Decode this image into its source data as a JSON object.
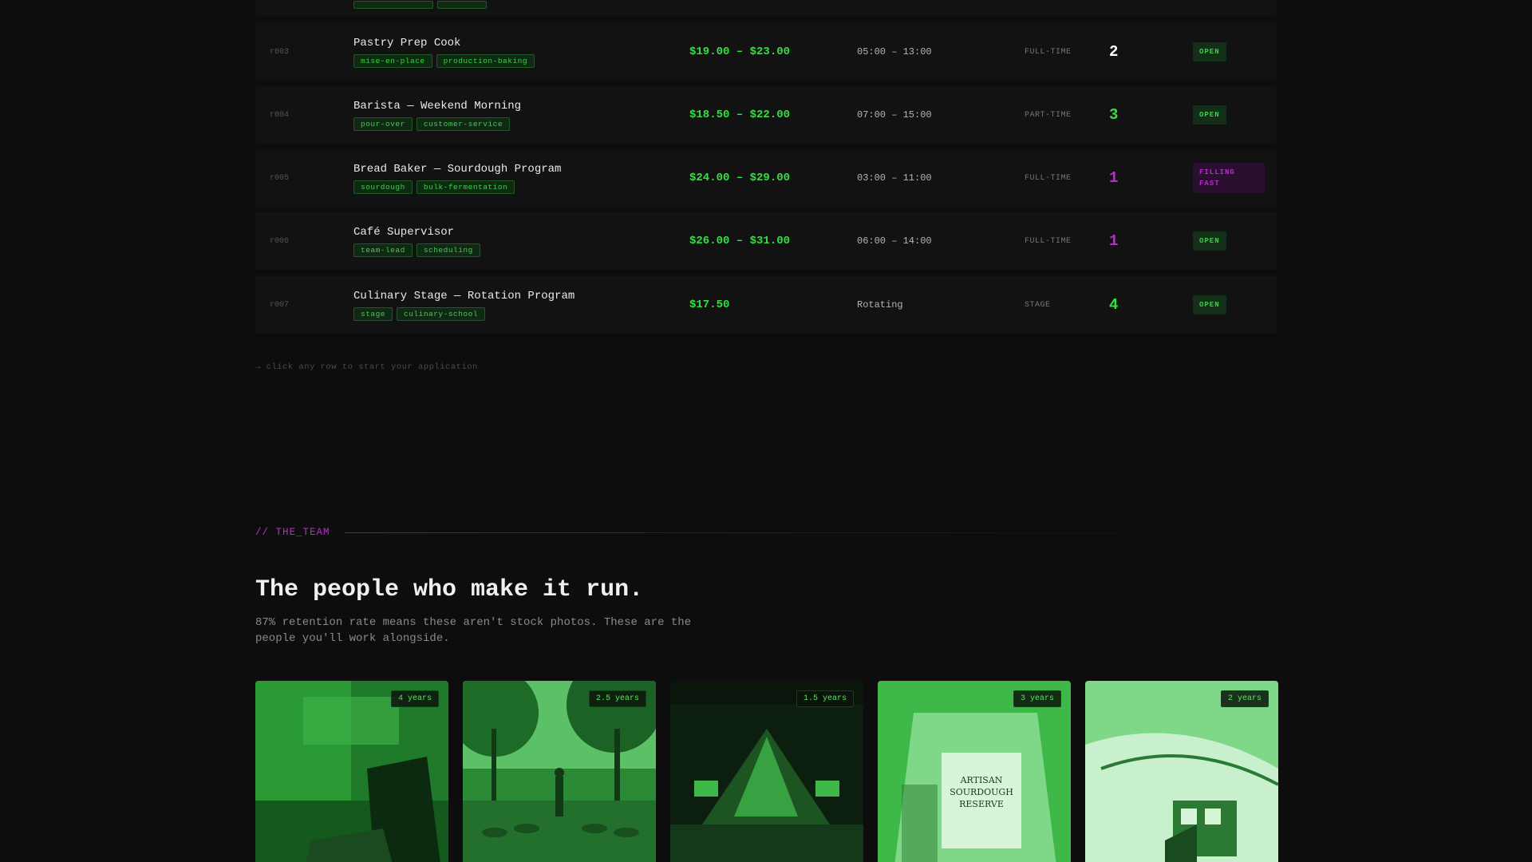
{
  "roles": [
    {
      "id": "r003",
      "title": "Pastry Prep Cook",
      "tags": [
        "mise-en-place",
        "production-baking"
      ],
      "pay": "$19.00 – $23.00",
      "shift": "05:00 – 13:00",
      "type": "FULL-TIME",
      "openings": "2",
      "openings_color": "#ffffff",
      "status": "OPEN"
    },
    {
      "id": "r004",
      "title": "Barista — Weekend Morning",
      "tags": [
        "pour-over",
        "customer-service"
      ],
      "pay": "$18.50 – $22.00",
      "shift": "07:00 – 15:00",
      "type": "PART-TIME",
      "openings": "3",
      "openings_color": "#33e03f",
      "status": "OPEN"
    },
    {
      "id": "r005",
      "title": "Bread Baker — Sourdough Program",
      "tags": [
        "sourdough",
        "bulk-fermentation"
      ],
      "pay": "$24.00 – $29.00",
      "shift": "03:00 – 11:00",
      "type": "FULL-TIME",
      "openings": "1",
      "openings_color": "#c026d3",
      "status": "FILLING FAST"
    },
    {
      "id": "r006",
      "title": "Café Supervisor",
      "tags": [
        "team-lead",
        "scheduling"
      ],
      "pay": "$26.00 – $31.00",
      "shift": "06:00 – 14:00",
      "type": "FULL-TIME",
      "openings": "1",
      "openings_color": "#c026d3",
      "status": "OPEN"
    },
    {
      "id": "r007",
      "title": "Culinary Stage — Rotation Program",
      "tags": [
        "stage",
        "culinary-school"
      ],
      "pay": "$17.50",
      "shift": "Rotating",
      "type": "STAGE",
      "openings": "4",
      "openings_color": "#33e03f",
      "status": "OPEN"
    }
  ],
  "hint": "→ click any row to start your application",
  "team": {
    "section_tag": "// THE_TEAM",
    "title": "The people who make it run.",
    "subtitle": "87% retention rate means these aren't stock photos. These are the people you'll work alongside.",
    "cards": [
      {
        "tenure": "4 years",
        "image": "laptop-photo"
      },
      {
        "tenure": "2.5 years",
        "image": "park-workout-photo"
      },
      {
        "tenure": "1.5 years",
        "image": "concert-stage-photo"
      },
      {
        "tenure": "3 years",
        "image": "sourdough-bag-photo",
        "bag_text": "ARTISAN SOURDOUGH RESERVE"
      },
      {
        "tenure": "2 years",
        "image": "cruise-ship-photo"
      }
    ]
  }
}
